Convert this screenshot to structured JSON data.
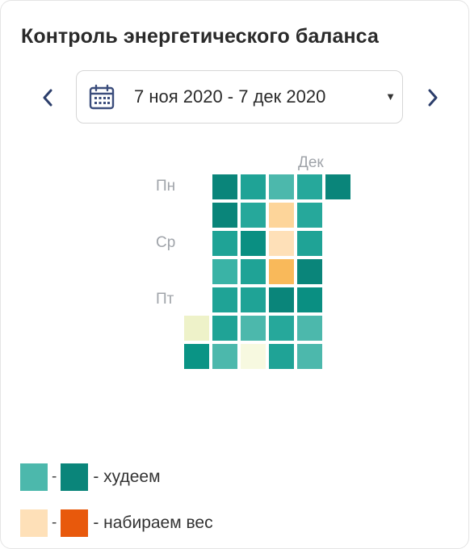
{
  "title": "Контроль энергетического баланса",
  "date_range": {
    "label": "7 ноя 2020 - 7 дек 2020",
    "prev_icon": "chevron-left-icon",
    "next_icon": "chevron-right-icon",
    "calendar_icon": "calendar-icon",
    "dropdown_icon": "caret-down-icon"
  },
  "heatmap": {
    "month_label": "Дек",
    "day_labels": {
      "mon": "Пн",
      "wed": "Ср",
      "fri": "Пт"
    },
    "rows": [
      [
        null,
        "#0a857a",
        "#1fa396",
        "#4cb8ac",
        "#26a89b",
        "#0a857a"
      ],
      [
        null,
        "#0a857a",
        "#26a89b",
        "#fdd59a",
        "#26a89b",
        null
      ],
      [
        null,
        "#1fa396",
        "#0a8f82",
        "#fee0b8",
        "#1fa396",
        null
      ],
      [
        null,
        "#3ab3a6",
        "#1fa396",
        "#f9b95a",
        "#0a857a",
        null
      ],
      [
        null,
        "#1fa396",
        "#1fa396",
        "#0a857a",
        "#0a8f82",
        null
      ],
      [
        "#eef2c9",
        "#1fa396",
        "#4cb8ac",
        "#26a89b",
        "#4cb8ac",
        null
      ],
      [
        "#0a9485",
        "#4cb8ac",
        "#f7f9e0",
        "#1fa396",
        "#4cb8ac",
        null
      ]
    ]
  },
  "legend": [
    {
      "from_color": "#4cb8ac",
      "to_color": "#0a857a",
      "separator": "-",
      "label": "- худеем"
    },
    {
      "from_color": "#fee0b8",
      "to_color": "#e8590c",
      "separator": "-",
      "label": "- набираем вес"
    }
  ]
}
